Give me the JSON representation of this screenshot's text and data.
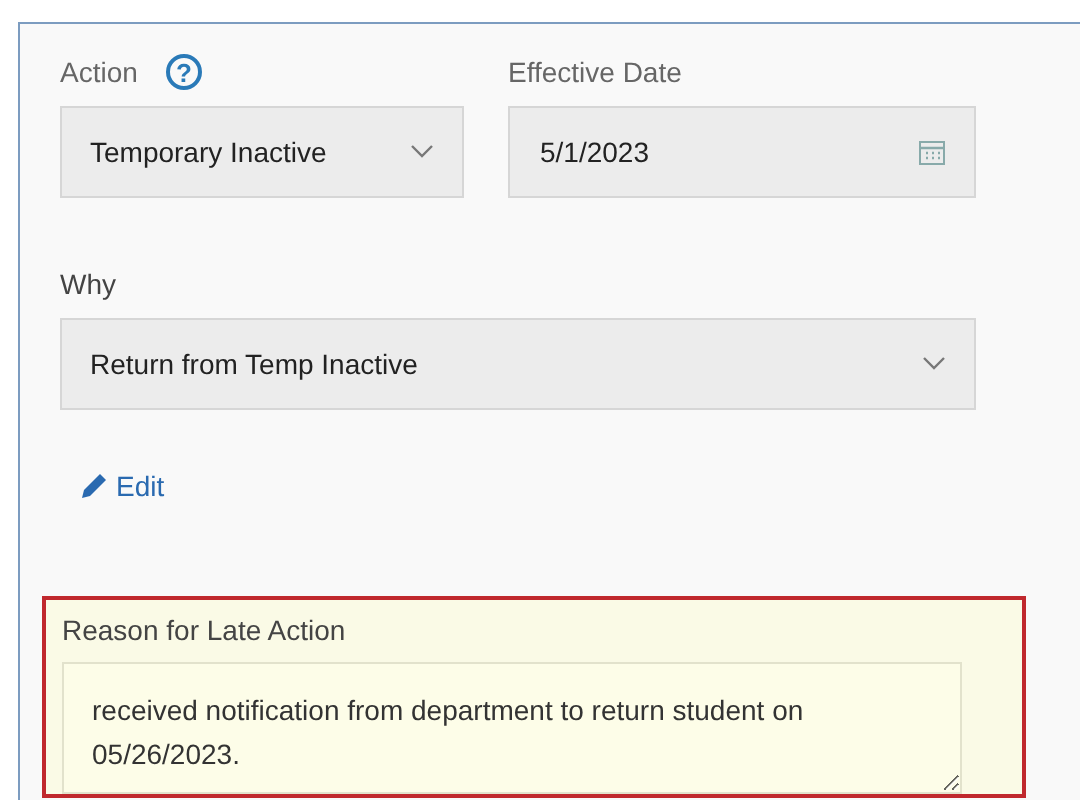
{
  "action": {
    "label": "Action",
    "help": "?",
    "value": "Temporary Inactive"
  },
  "effective_date": {
    "label": "Effective Date",
    "value": "5/1/2023"
  },
  "why": {
    "label": "Why",
    "value": "Return from Temp Inactive"
  },
  "edit_link": {
    "label": "Edit"
  },
  "late_reason": {
    "label": "Reason for Late Action",
    "highlighted": true,
    "value": "received notification from department to return student on 05/26/2023."
  }
}
